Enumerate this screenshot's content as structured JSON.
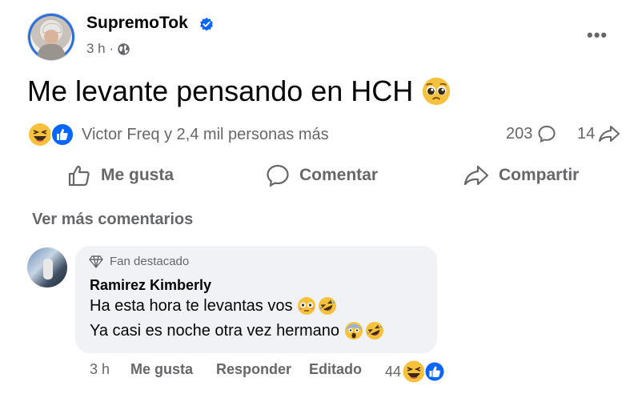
{
  "post": {
    "author": "SupremoTok",
    "time": "3 h ·",
    "text": "Me levante pensando en HCH",
    "reactions_summary": "Victor Freq y 2,4 mil personas más",
    "comments_count": "203",
    "shares_count": "14"
  },
  "actions": {
    "like": "Me gusta",
    "comment": "Comentar",
    "share": "Compartir"
  },
  "see_more_comments": "Ver más comentarios",
  "comment": {
    "badge": "Fan destacado",
    "author": "Ramirez Kimberly",
    "line1": "Ha esta hora te levantas vos",
    "line2": "Ya casi es noche otra vez hermano",
    "time": "3 h",
    "like_label": "Me gusta",
    "reply_label": "Responder",
    "edited_label": "Editado",
    "reaction_count": "44"
  },
  "colors": {
    "accent_blue": "#0866ff",
    "secondary_text": "#65676b",
    "bubble_bg": "#f0f2f5",
    "emoji_yellow": "#f7c23b"
  },
  "icons": [
    "verified-badge-icon",
    "globe-icon",
    "more-icon",
    "pleading-face-icon",
    "haha-reaction-icon",
    "like-reaction-icon",
    "comment-icon",
    "share-icon",
    "thumbs-up-icon",
    "diamond-icon",
    "flushed-face-icon",
    "rofl-icon",
    "scream-face-icon"
  ]
}
